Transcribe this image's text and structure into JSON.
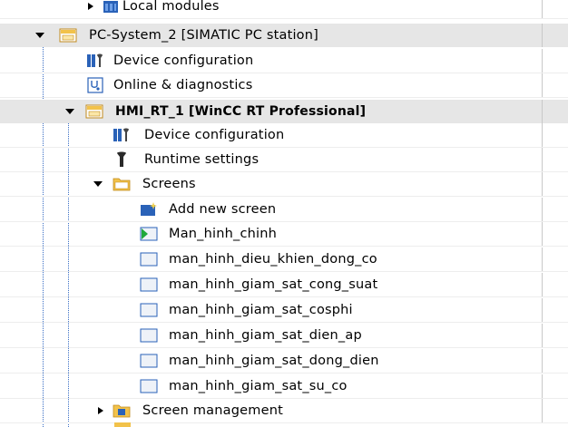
{
  "tree": {
    "local_modules": "Local modules",
    "pc_system": "PC-System_2 [SIMATIC PC station]",
    "pc_device_config": "Device configuration",
    "pc_online_diag": "Online & diagnostics",
    "hmi_rt": "HMI_RT_1 [WinCC RT Professional]",
    "hmi_device_config": "Device configuration",
    "runtime_settings": "Runtime settings",
    "screens": "Screens",
    "add_new_screen": "Add new screen",
    "screen_items": [
      "Man_hinh_chinh",
      "man_hinh_dieu_khien_dong_co",
      "man_hinh_giam_sat_cong_suat",
      "man_hinh_giam_sat_cosphi",
      "man_hinh_giam_sat_dien_ap",
      "man_hinh_giam_sat_dong_dien",
      "man_hinh_giam_sat_su_co"
    ],
    "screen_management": "Screen management"
  },
  "icons": {
    "folder": "folder-icon",
    "device_config": "device-configuration-icon",
    "online_diag": "online-diagnostics-icon",
    "runtime": "runtime-settings-icon",
    "add_screen": "add-screen-icon",
    "start_screen": "start-screen-icon",
    "screen": "screen-icon"
  },
  "colors": {
    "selected_row": "#e6e6e6",
    "folder_yellow": "#f2c24a",
    "blue_accent": "#2a62b8",
    "tree_line": "#3b6fc5"
  }
}
